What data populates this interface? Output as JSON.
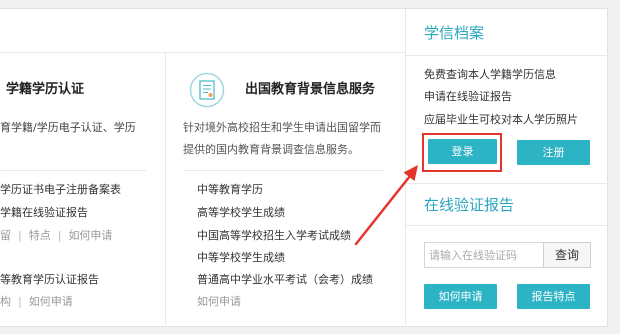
{
  "colors": {
    "accent": "#2cb4c5",
    "title": "#2aa7bf",
    "annotation": "#e5352a"
  },
  "icons": {
    "middle_service": "document-icon",
    "annotation": "arrow-icon"
  },
  "left": {
    "heading": "学籍学历认证",
    "desc": "育学籍/学历电子认证、学历",
    "separator": "|",
    "item1": "学历证书电子注册备案表",
    "item2": "学籍在线验证报告",
    "links1": [
      "留",
      "特点",
      "如何申请"
    ],
    "item3": "等教育学历认证报告",
    "links2": [
      "构",
      "如何申请"
    ]
  },
  "middle": {
    "heading": "出国教育背景信息服务",
    "desc_lines": [
      "针对境外高校招生和学生申请出国留学而",
      "提供的国内教育背景调查信息服务。"
    ],
    "items": [
      "中等教育学历",
      "高等学校学生成绩",
      "中国高等学校招生入学考试成绩",
      "中等学校学生成绩",
      "普通高中学业水平考试（会考）成绩"
    ],
    "apply_link": "如何申请"
  },
  "right": {
    "archive": {
      "title": "学信档案",
      "features": [
        "免费查询本人学籍学历信息",
        "申请在线验证报告",
        "应届毕业生可校对本人学历照片"
      ],
      "login_label": "登录",
      "register_label": "注册"
    },
    "verify": {
      "title": "在线验证报告",
      "code_input": {
        "value": "",
        "placeholder": "请输入在线验证码"
      },
      "query_label": "查询",
      "how_to_apply_label": "如何申请",
      "report_features_label": "报告特点"
    }
  }
}
